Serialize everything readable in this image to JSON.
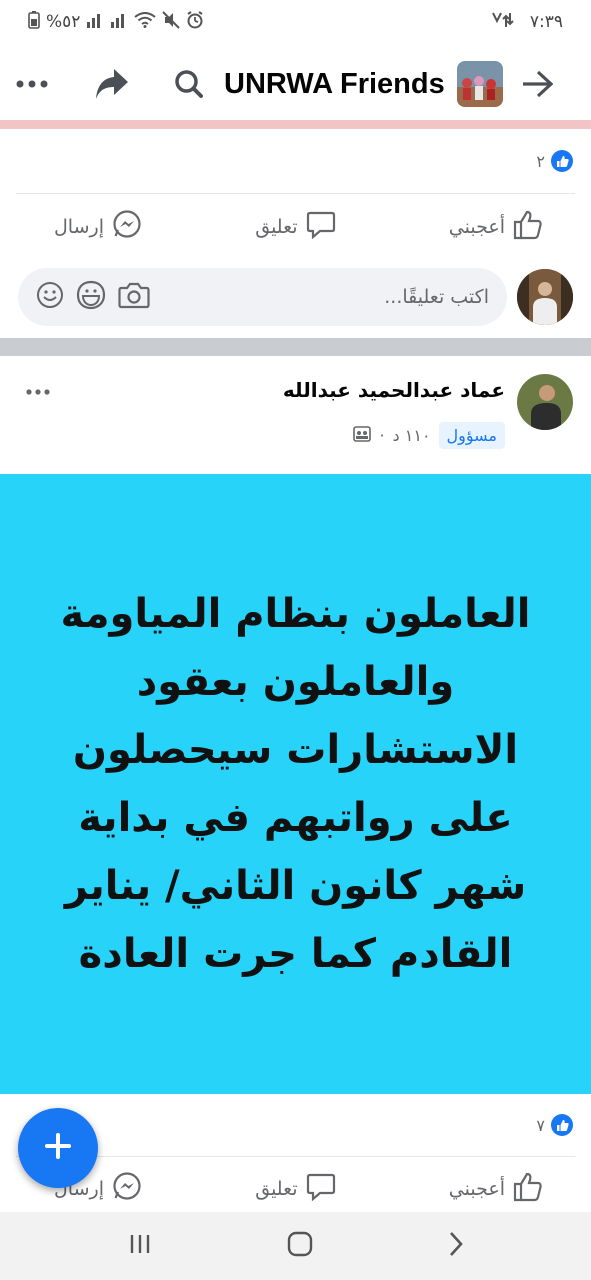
{
  "status_bar": {
    "time": "٧:٣٩",
    "battery": "%٥٢",
    "icons": [
      "battery-icon",
      "signal-icon",
      "signal-icon",
      "wifi-icon",
      "mute-icon",
      "alarm-icon",
      "data-icon"
    ]
  },
  "header": {
    "title": "UNRWA Friends",
    "icons": [
      "back-arrow-icon",
      "group-avatar",
      "search-icon",
      "share-icon",
      "more-icon"
    ]
  },
  "post1": {
    "like_count": "٢",
    "actions": {
      "like": "أعجبني",
      "comment": "تعليق",
      "send": "إرسال"
    },
    "comment_placeholder": "اكتب تعليقًا..."
  },
  "post2": {
    "author": "عماد عبدالحميد عبدالله",
    "badge": "مسؤول",
    "time": "١١٠ د",
    "dot": "·",
    "image_text": "العاملون بنظام المياومة والعاملون بعقود الاستشارات  سيحصلون على رواتبهم في بداية شهر كانون الثاني/ يناير القادم كما جرت العادة",
    "image_bg": "#27d3f8",
    "like_count": "٧",
    "actions": {
      "like": "أعجبني",
      "comment": "تعليق",
      "send": "إرسال"
    }
  },
  "accent_color": "#1877f2"
}
